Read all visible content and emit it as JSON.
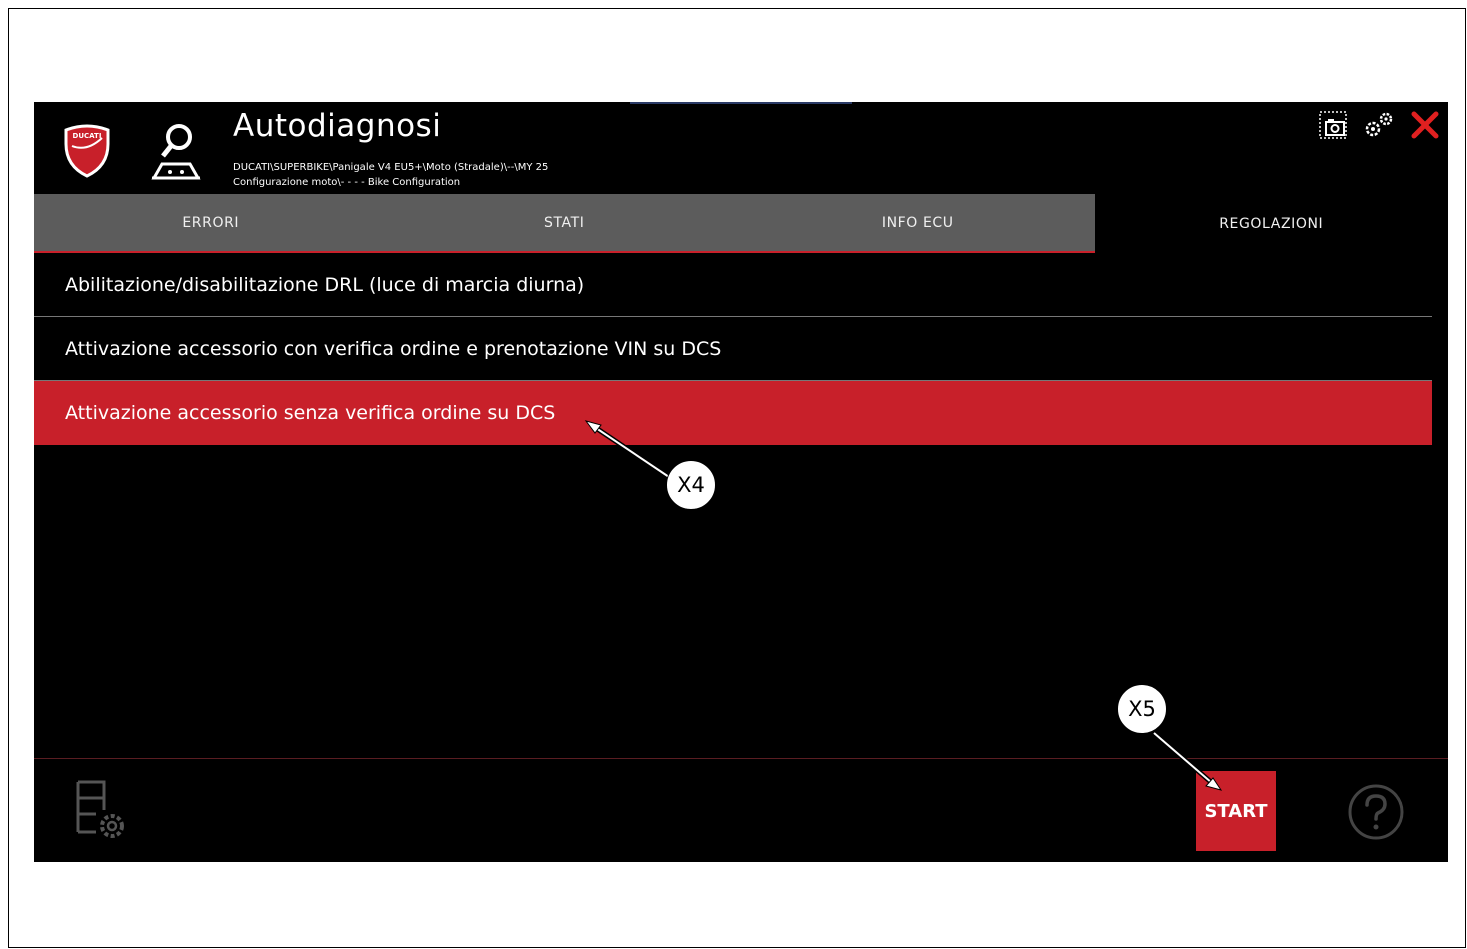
{
  "app": {
    "title": "Autodiagnosi",
    "path_line1": "DUCATI\\SUPERBIKE\\Panigale V4 EU5+\\Moto (Stradale)\\--\\MY 25",
    "path_line2": "Configurazione moto\\- - - - Bike Configuration",
    "logo_text": "DUCATI"
  },
  "header_icons": [
    "screenshot-icon",
    "settings-gears-icon",
    "close-icon"
  ],
  "tabs": [
    {
      "label": "ERRORI",
      "active": false
    },
    {
      "label": "STATI",
      "active": false
    },
    {
      "label": "INFO ECU",
      "active": false
    },
    {
      "label": "REGOLAZIONI",
      "active": true
    }
  ],
  "list": {
    "items": [
      {
        "label": "Abilitazione/disabilitazione DRL (luce di marcia diurna)",
        "selected": false
      },
      {
        "label": "Attivazione accessorio con verifica ordine e prenotazione VIN su DCS",
        "selected": false
      },
      {
        "label": "Attivazione accessorio senza verifica ordine su DCS",
        "selected": true
      }
    ]
  },
  "footer": {
    "start_label": "START"
  },
  "callouts": {
    "x4": "X4",
    "x5": "X5"
  },
  "colors": {
    "accent": "#c8202a",
    "background": "#000000",
    "tab_bg": "#5c5c5c"
  }
}
